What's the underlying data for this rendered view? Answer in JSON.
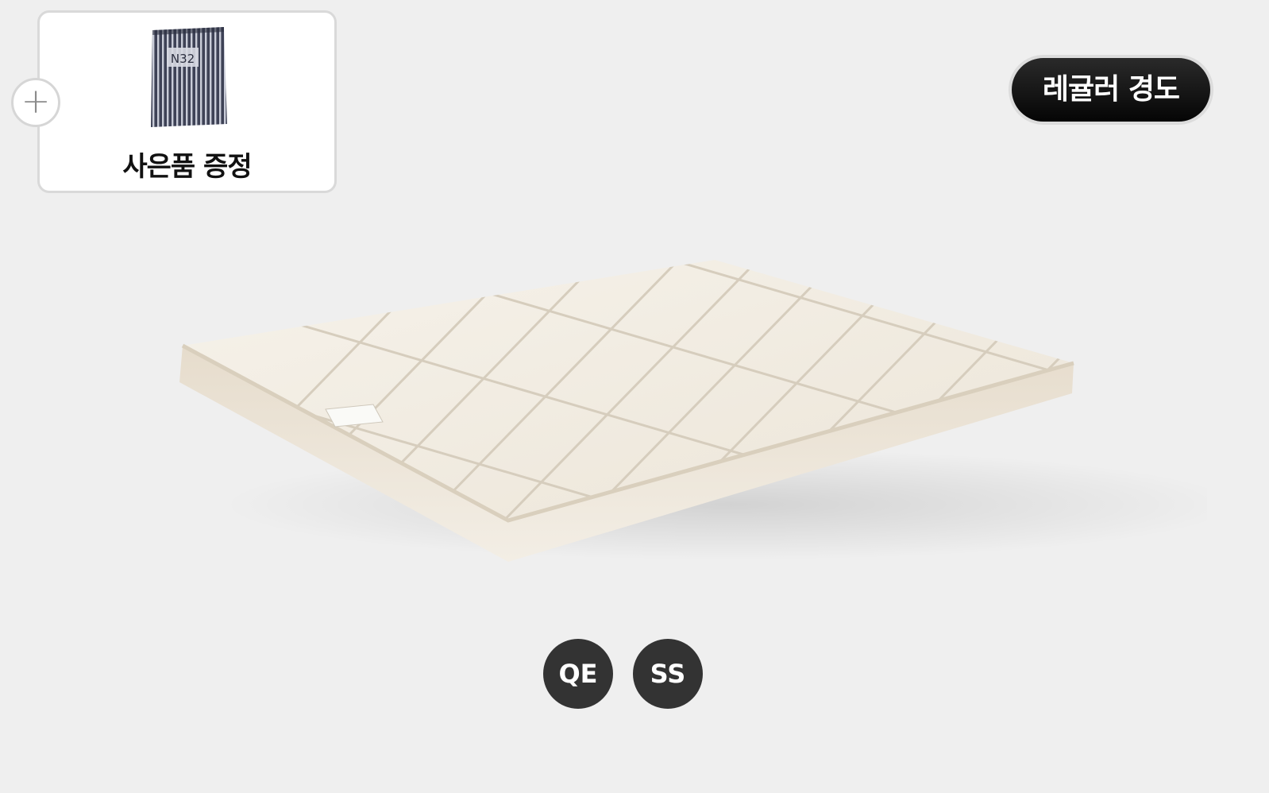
{
  "gift": {
    "plus_symbol": "+",
    "label": "사은품 증정",
    "package_brand": "N32"
  },
  "badge": {
    "firmness_label": "레귤러 경도"
  },
  "sizes": [
    {
      "label": "QE"
    },
    {
      "label": "SS"
    }
  ],
  "colors": {
    "background": "#efefef",
    "badge_bg": "#0a0a0a",
    "size_button_bg": "#333333",
    "mattress_fabric": "#efe9de"
  }
}
